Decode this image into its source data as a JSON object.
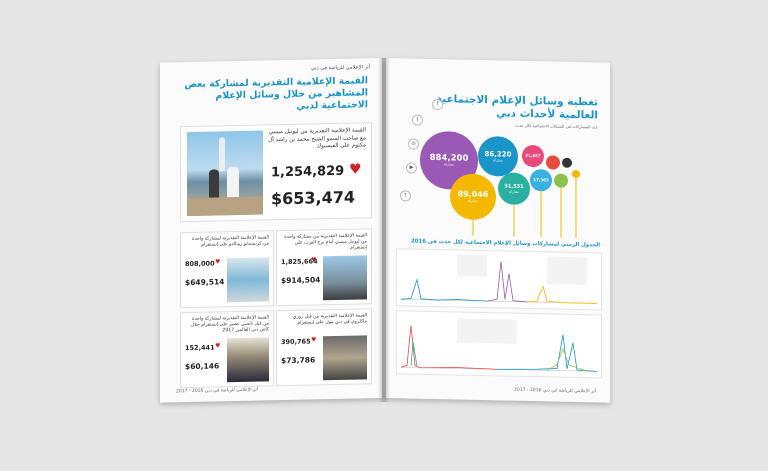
{
  "left_page": {
    "header": "أثر الإعلامي للرياضة في دبي",
    "title": "القيمة الإعلامية التقديرية لمشاركة بعض المشاهير من خلال وسائل الإعلام الاجتماعية لدبي",
    "main_card": {
      "label": "القيمة الإعلامية التقديرية من ليونيل ميسي مع صاحب السمو الشيخ محمد بن راشد آل مكتوم على الفيسبوك",
      "likes": "1,254,829",
      "value": "$653,474"
    },
    "cards": [
      {
        "label": "القيمة الإعلامية التقديرية من مشاركة واحدة من ليونيل ميسي أمام برج العرب على إنستغرام",
        "likes": "1,825,664",
        "value": "$914,504"
      },
      {
        "label": "القيمة الإعلامية التقديرية لمشاركة واحدة من كريستيانو رونالدو على إنستغرام",
        "likes": "808,000",
        "value": "$649,514"
      },
      {
        "label": "القيمة الإعلامية التقديرية من قبل روري ماكلروي في دبي مول على إنستغرام",
        "likes": "390,765",
        "value": "$73,786"
      },
      {
        "label": "القيمة الإعلامية التقديرية لمشاركة واحدة من فيل ناتسي عصير على إنستغرام خلال كأس دبي العالمي 2017",
        "likes": "152,441",
        "value": "$60,146"
      }
    ],
    "footer": "أثر الإعلامي للرياضة في دبي 2016 - 2017"
  },
  "right_page": {
    "title": "تغطية وسائل الإعلام الاجتماعية العالمية لأحداث دبي",
    "subtitle": "عدد المشاركات في الشبكات الاجتماعية لكل حدث",
    "bubbles": [
      {
        "value": "884,200",
        "text": "مشاركة",
        "color": "#9b59b6"
      },
      {
        "value": "89,046",
        "text": "مشاركة",
        "color": "#f5b800"
      },
      {
        "value": "86,220",
        "text": "مشاركة",
        "color": "#1a95c9"
      },
      {
        "value": "51,531",
        "text": "مشاركة",
        "color": "#2ab0a0"
      },
      {
        "value": "21,657",
        "text": "",
        "color": "#e84b7a"
      },
      {
        "value": "17,363",
        "text": "",
        "color": "#3ab0e0"
      },
      {
        "value": "",
        "text": "",
        "color": "#8bc34a"
      },
      {
        "value": "",
        "text": "",
        "color": "#e74c3c"
      },
      {
        "value": "",
        "text": "",
        "color": "#333333"
      }
    ],
    "timeline_title": "الجدول الزمني لمشاركات وسائل الإعلام الاجتماعية لكل حدث في 2016",
    "footer": "أثر الإعلامي للرياضة في دبي 2016 - 2017"
  },
  "colors": {
    "accent": "#1a95c9",
    "heart": "#d5232a"
  }
}
